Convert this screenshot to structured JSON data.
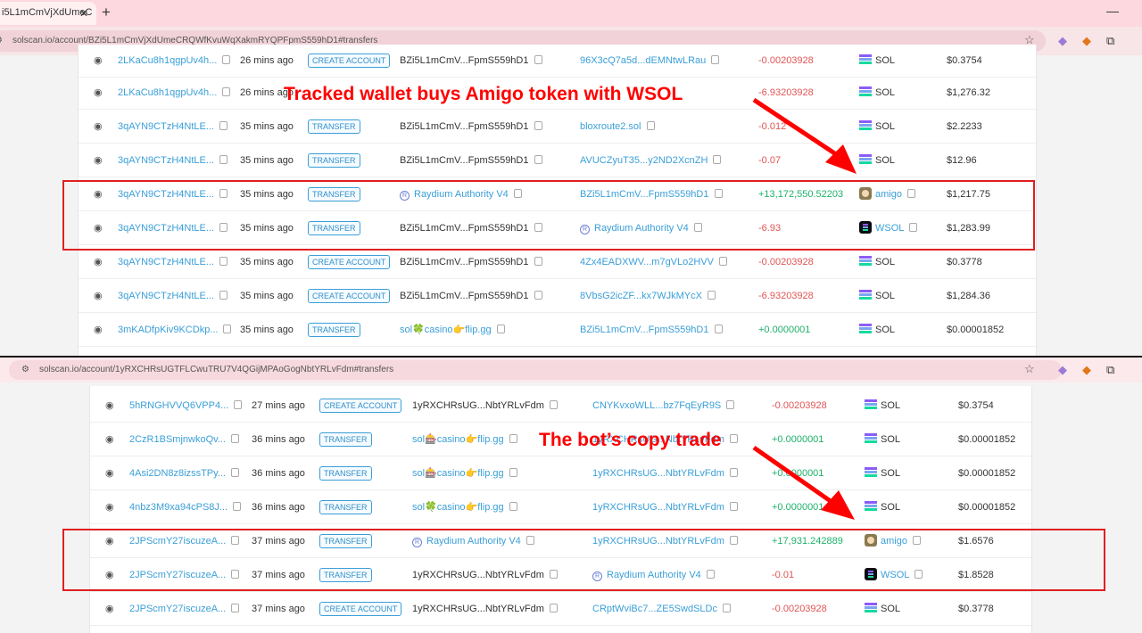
{
  "screenshot_top": {
    "tab_title": "i5L1mCmVjXdUmeC",
    "url": "solscan.io/account/BZi5L1mCmVjXdUmeCRQWfKvuWqXakmRYQPFpmS559hD1#transfers",
    "annotation": "Tracked wallet buys Amigo token with WSOL",
    "rows": [
      {
        "sig": "2LKaCu8h1qgpUv4h...",
        "time": "26 mins ago",
        "action": "CREATE ACCOUNT",
        "from": "BZi5L1mCmV...FpmS559hD1",
        "to": "96X3cQ7a5d...dEMNtwLRau",
        "amount": "-0.00203928",
        "sign": "neg",
        "token": "SOL",
        "token_icon": "sol",
        "value": "$0.3754"
      },
      {
        "sig": "2LKaCu8h1qgpUv4h...",
        "time": "26 mins ago",
        "action": "",
        "from": "",
        "to": "",
        "amount": "-6.93203928",
        "sign": "neg",
        "token": "SOL",
        "token_icon": "sol",
        "value": "$1,276.32"
      },
      {
        "sig": "3qAYN9CTzH4NtLE...",
        "time": "35 mins ago",
        "action": "TRANSFER",
        "from": "BZi5L1mCmV...FpmS559hD1",
        "to": "bloxroute2.sol",
        "amount": "-0.012",
        "sign": "neg",
        "token": "SOL",
        "token_icon": "sol",
        "value": "$2.2233"
      },
      {
        "sig": "3qAYN9CTzH4NtLE...",
        "time": "35 mins ago",
        "action": "TRANSFER",
        "from": "BZi5L1mCmV...FpmS559hD1",
        "to": "AVUCZyuT35...y2ND2XcnZH",
        "amount": "-0.07",
        "sign": "neg",
        "token": "SOL",
        "token_icon": "sol",
        "value": "$12.96"
      },
      {
        "sig": "3qAYN9CTzH4NtLE...",
        "time": "35 mins ago",
        "action": "TRANSFER",
        "from": "Raydium Authority V4",
        "from_ray": true,
        "to": "BZi5L1mCmV...FpmS559hD1",
        "amount": "+13,172,550.52203",
        "sign": "pos",
        "token": "amigo",
        "token_icon": "amigo",
        "token_link": true,
        "value": "$1,217.75"
      },
      {
        "sig": "3qAYN9CTzH4NtLE...",
        "time": "35 mins ago",
        "action": "TRANSFER",
        "from": "BZi5L1mCmV...FpmS559hD1",
        "to": "Raydium Authority V4",
        "to_ray": true,
        "amount": "-6.93",
        "sign": "neg",
        "token": "WSOL",
        "token_icon": "wsol",
        "token_link": true,
        "value": "$1,283.99"
      },
      {
        "sig": "3qAYN9CTzH4NtLE...",
        "time": "35 mins ago",
        "action": "CREATE ACCOUNT",
        "from": "BZi5L1mCmV...FpmS559hD1",
        "to": "4Zx4EADXWV...m7gVLo2HVV",
        "amount": "-0.00203928",
        "sign": "neg",
        "token": "SOL",
        "token_icon": "sol",
        "value": "$0.3778"
      },
      {
        "sig": "3qAYN9CTzH4NtLE...",
        "time": "35 mins ago",
        "action": "CREATE ACCOUNT",
        "from": "BZi5L1mCmV...FpmS559hD1",
        "to": "8VbsG2icZF...kx7WJkMYcX",
        "amount": "-6.93203928",
        "sign": "neg",
        "token": "SOL",
        "token_icon": "sol",
        "value": "$1,284.36"
      },
      {
        "sig": "3mKADfpKiv9KCDkp...",
        "time": "35 mins ago",
        "action": "TRANSFER",
        "from": "sol🍀casino👉flip.gg",
        "from_link": true,
        "to": "BZi5L1mCmV...FpmS559hD1",
        "amount": "+0.0000001",
        "sign": "pos",
        "token": "SOL",
        "token_icon": "sol",
        "value": "$0.00001852"
      }
    ]
  },
  "screenshot_bottom": {
    "url": "solscan.io/account/1yRXCHRsUGTFLCwuTRU7V4QGijMPAoGogNbtYRLvFdm#transfers",
    "annotation": "The bot’s copy trade",
    "rows": [
      {
        "sig": "5hRNGHVVQ6VPP4...",
        "time": "27 mins ago",
        "action": "CREATE ACCOUNT",
        "from": "1yRXCHRsUG...NbtYRLvFdm",
        "to": "CNYKvxoWLL...bz7FqEyR9S",
        "amount": "-0.00203928",
        "sign": "neg",
        "token": "SOL",
        "token_icon": "sol",
        "value": "$0.3754"
      },
      {
        "sig": "2CzR1BSmjnwkoQv...",
        "time": "36 mins ago",
        "action": "TRANSFER",
        "from": "sol🎰casino👉flip.gg",
        "from_link": true,
        "to": "1yRXCHRsUG...NbtYRLvFdm",
        "amount": "+0.0000001",
        "sign": "pos",
        "token": "SOL",
        "token_icon": "sol",
        "value": "$0.00001852"
      },
      {
        "sig": "4Asi2DN8z8izssTPy...",
        "time": "36 mins ago",
        "action": "TRANSFER",
        "from": "sol🎰casino👉flip.gg",
        "from_link": true,
        "to": "1yRXCHRsUG...NbtYRLvFdm",
        "amount": "+0.0000001",
        "sign": "pos",
        "token": "SOL",
        "token_icon": "sol",
        "value": "$0.00001852"
      },
      {
        "sig": "4nbz3M9xa94cPS8J...",
        "time": "36 mins ago",
        "action": "TRANSFER",
        "from": "sol🍀casino👉flip.gg",
        "from_link": true,
        "to": "1yRXCHRsUG...NbtYRLvFdm",
        "amount": "+0.0000001",
        "sign": "pos",
        "token": "SOL",
        "token_icon": "sol",
        "value": "$0.00001852"
      },
      {
        "sig": "2JPScmY27iscuzeA...",
        "time": "37 mins ago",
        "action": "TRANSFER",
        "from": "Raydium Authority V4",
        "from_ray": true,
        "to": "1yRXCHRsUG...NbtYRLvFdm",
        "amount": "+17,931.242889",
        "sign": "pos",
        "token": "amigo",
        "token_icon": "amigo",
        "token_link": true,
        "value": "$1.6576"
      },
      {
        "sig": "2JPScmY27iscuzeA...",
        "time": "37 mins ago",
        "action": "TRANSFER",
        "from": "1yRXCHRsUG...NbtYRLvFdm",
        "to": "Raydium Authority V4",
        "to_ray": true,
        "amount": "-0.01",
        "sign": "neg",
        "token": "WSOL",
        "token_icon": "wsol",
        "token_link": true,
        "value": "$1.8528"
      },
      {
        "sig": "2JPScmY27iscuzeA...",
        "time": "37 mins ago",
        "action": "CREATE ACCOUNT",
        "from": "1yRXCHRsUG...NbtYRLvFdm",
        "to": "CRptWviBc7...ZE5SwdSLDc",
        "amount": "-0.00203928",
        "sign": "neg",
        "token": "SOL",
        "token_icon": "sol",
        "value": "$0.3778"
      }
    ]
  },
  "colors": {
    "accent_blue": "#3a9fd8",
    "negative": "#e05555",
    "positive": "#1eb26a",
    "annotation_red": "#ff0000",
    "tab_bar": "#fdd8de"
  },
  "icons": {
    "eye": "eye-icon",
    "copy": "copy-icon",
    "star": "star-icon",
    "raydium": "raydium-icon",
    "sol": "sol-token-icon",
    "amigo": "amigo-token-icon",
    "wsol": "wsol-token-icon"
  }
}
